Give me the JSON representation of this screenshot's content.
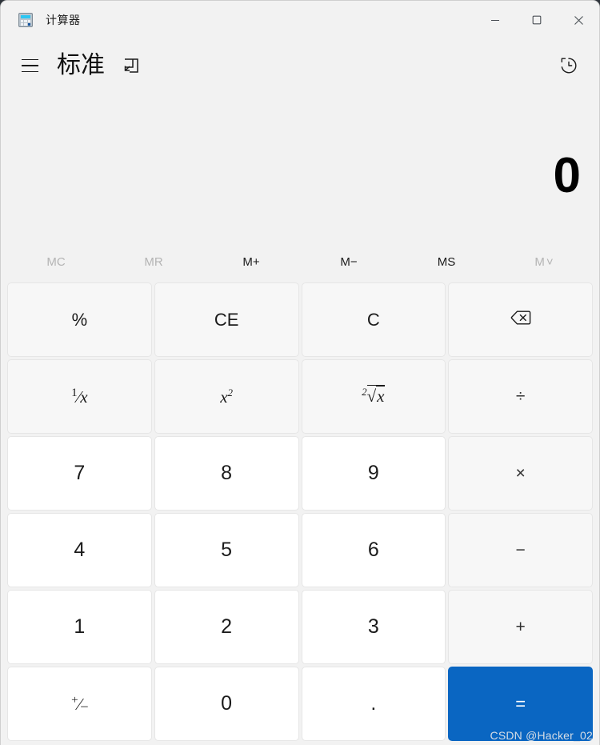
{
  "window": {
    "title": "计算器",
    "app_icon": "calculator-icon",
    "controls": {
      "minimize": "minimize-icon",
      "maximize": "maximize-icon",
      "close": "close-icon"
    }
  },
  "header": {
    "menu_icon": "hamburger-menu-icon",
    "mode": "标准",
    "keep_on_top_icon": "keep-on-top-icon",
    "history_icon": "history-icon"
  },
  "display": {
    "value": "0"
  },
  "memory": {
    "buttons": [
      {
        "label": "MC",
        "name": "memory-clear-button",
        "disabled": true
      },
      {
        "label": "MR",
        "name": "memory-recall-button",
        "disabled": true
      },
      {
        "label": "M+",
        "name": "memory-add-button",
        "disabled": false
      },
      {
        "label": "M−",
        "name": "memory-subtract-button",
        "disabled": false
      },
      {
        "label": "MS",
        "name": "memory-store-button",
        "disabled": false
      },
      {
        "label": "M",
        "name": "memory-dropdown-button",
        "disabled": true,
        "chevron": "˅"
      }
    ]
  },
  "keypad": {
    "rows": [
      [
        {
          "label": "%",
          "name": "percent-button",
          "kind": "fn"
        },
        {
          "label": "CE",
          "name": "clear-entry-button",
          "kind": "fn"
        },
        {
          "label": "C",
          "name": "clear-button",
          "kind": "fn"
        },
        {
          "label": "",
          "name": "backspace-button",
          "kind": "fn",
          "icon": "backspace-icon"
        }
      ],
      [
        {
          "label": "1/x",
          "name": "reciprocal-button",
          "kind": "fn",
          "glyph": "reciprocal"
        },
        {
          "label": "x2",
          "name": "square-button",
          "kind": "fn",
          "glyph": "square"
        },
        {
          "label": "2√x",
          "name": "square-root-button",
          "kind": "fn",
          "glyph": "sqrt"
        },
        {
          "label": "÷",
          "name": "divide-button",
          "kind": "op"
        }
      ],
      [
        {
          "label": "7",
          "name": "digit-7-button",
          "kind": "num"
        },
        {
          "label": "8",
          "name": "digit-8-button",
          "kind": "num"
        },
        {
          "label": "9",
          "name": "digit-9-button",
          "kind": "num"
        },
        {
          "label": "×",
          "name": "multiply-button",
          "kind": "op"
        }
      ],
      [
        {
          "label": "4",
          "name": "digit-4-button",
          "kind": "num"
        },
        {
          "label": "5",
          "name": "digit-5-button",
          "kind": "num"
        },
        {
          "label": "6",
          "name": "digit-6-button",
          "kind": "num"
        },
        {
          "label": "−",
          "name": "subtract-button",
          "kind": "op"
        }
      ],
      [
        {
          "label": "1",
          "name": "digit-1-button",
          "kind": "num"
        },
        {
          "label": "2",
          "name": "digit-2-button",
          "kind": "num"
        },
        {
          "label": "3",
          "name": "digit-3-button",
          "kind": "num"
        },
        {
          "label": "+",
          "name": "add-button",
          "kind": "op"
        }
      ],
      [
        {
          "label": "+/−",
          "name": "sign-toggle-button",
          "kind": "num",
          "glyph": "plusminus"
        },
        {
          "label": "0",
          "name": "digit-0-button",
          "kind": "num"
        },
        {
          "label": ".",
          "name": "decimal-point-button",
          "kind": "num"
        },
        {
          "label": "=",
          "name": "equals-button",
          "kind": "equals"
        }
      ]
    ]
  },
  "watermark": {
    "text": "CSDN @Hacker_02"
  },
  "colors": {
    "accent": "#0a66c2",
    "window_bg": "#f2f2f2",
    "number_key": "#ffffff",
    "function_key": "#f7f7f7",
    "disabled_text": "#b4b4b4"
  }
}
